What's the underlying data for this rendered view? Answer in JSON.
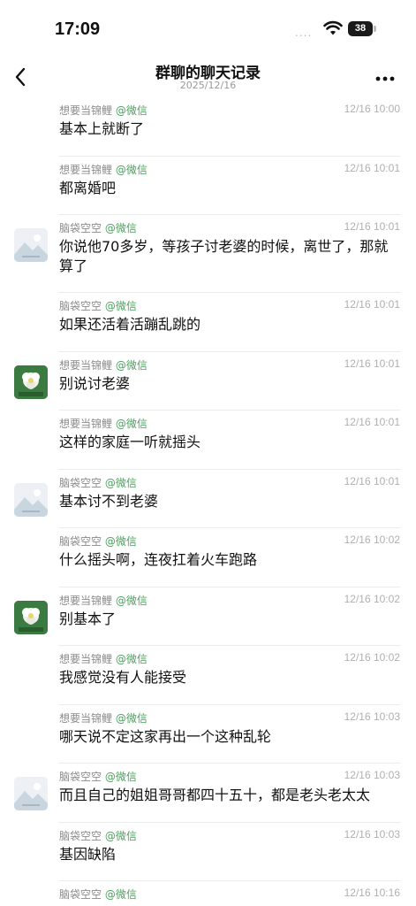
{
  "status_bar": {
    "time": "17:09",
    "signal": "....",
    "battery": "38"
  },
  "nav": {
    "title": "群聊的聊天记录",
    "subtitle": "2025/12/16"
  },
  "messages": [
    {
      "sender": "想要当锦鲤",
      "source": "@微信",
      "time": "12/16 10:00",
      "text": "基本上就断了",
      "avatar": ""
    },
    {
      "sender": "想要当锦鲤",
      "source": "@微信",
      "time": "12/16 10:01",
      "text": "都离婚吧",
      "avatar": ""
    },
    {
      "sender": "脑袋空空",
      "source": "@微信",
      "time": "12/16 10:01",
      "text": "你说他70多岁，等孩子讨老婆的时候，离世了，那就算了",
      "avatar": "landscape"
    },
    {
      "sender": "脑袋空空",
      "source": "@微信",
      "time": "12/16 10:01",
      "text": "如果还活着活蹦乱跳的",
      "avatar": ""
    },
    {
      "sender": "想要当锦鲤",
      "source": "@微信",
      "time": "12/16 10:01",
      "text": "别说讨老婆",
      "avatar": "flower"
    },
    {
      "sender": "想要当锦鲤",
      "source": "@微信",
      "time": "12/16 10:01",
      "text": "这样的家庭一听就摇头",
      "avatar": ""
    },
    {
      "sender": "脑袋空空",
      "source": "@微信",
      "time": "12/16 10:01",
      "text": "基本讨不到老婆",
      "avatar": "landscape"
    },
    {
      "sender": "脑袋空空",
      "source": "@微信",
      "time": "12/16 10:02",
      "text": "什么摇头啊，连夜扛着火车跑路",
      "avatar": ""
    },
    {
      "sender": "想要当锦鲤",
      "source": "@微信",
      "time": "12/16 10:02",
      "text": "别基本了",
      "avatar": "flower"
    },
    {
      "sender": "想要当锦鲤",
      "source": "@微信",
      "time": "12/16 10:02",
      "text": "我感觉没有人能接受",
      "avatar": ""
    },
    {
      "sender": "想要当锦鲤",
      "source": "@微信",
      "time": "12/16 10:03",
      "text": "哪天说不定这家再出一个这种乱轮",
      "avatar": ""
    },
    {
      "sender": "脑袋空空",
      "source": "@微信",
      "time": "12/16 10:03",
      "text": "而且自己的姐姐哥哥都四十五十，都是老头老太太",
      "avatar": "landscape"
    },
    {
      "sender": "脑袋空空",
      "source": "@微信",
      "time": "12/16 10:03",
      "text": "基因缺陷",
      "avatar": ""
    },
    {
      "sender": "脑袋空空",
      "source": "@微信",
      "time": "12/16 10:16",
      "text": "",
      "avatar": ""
    }
  ]
}
